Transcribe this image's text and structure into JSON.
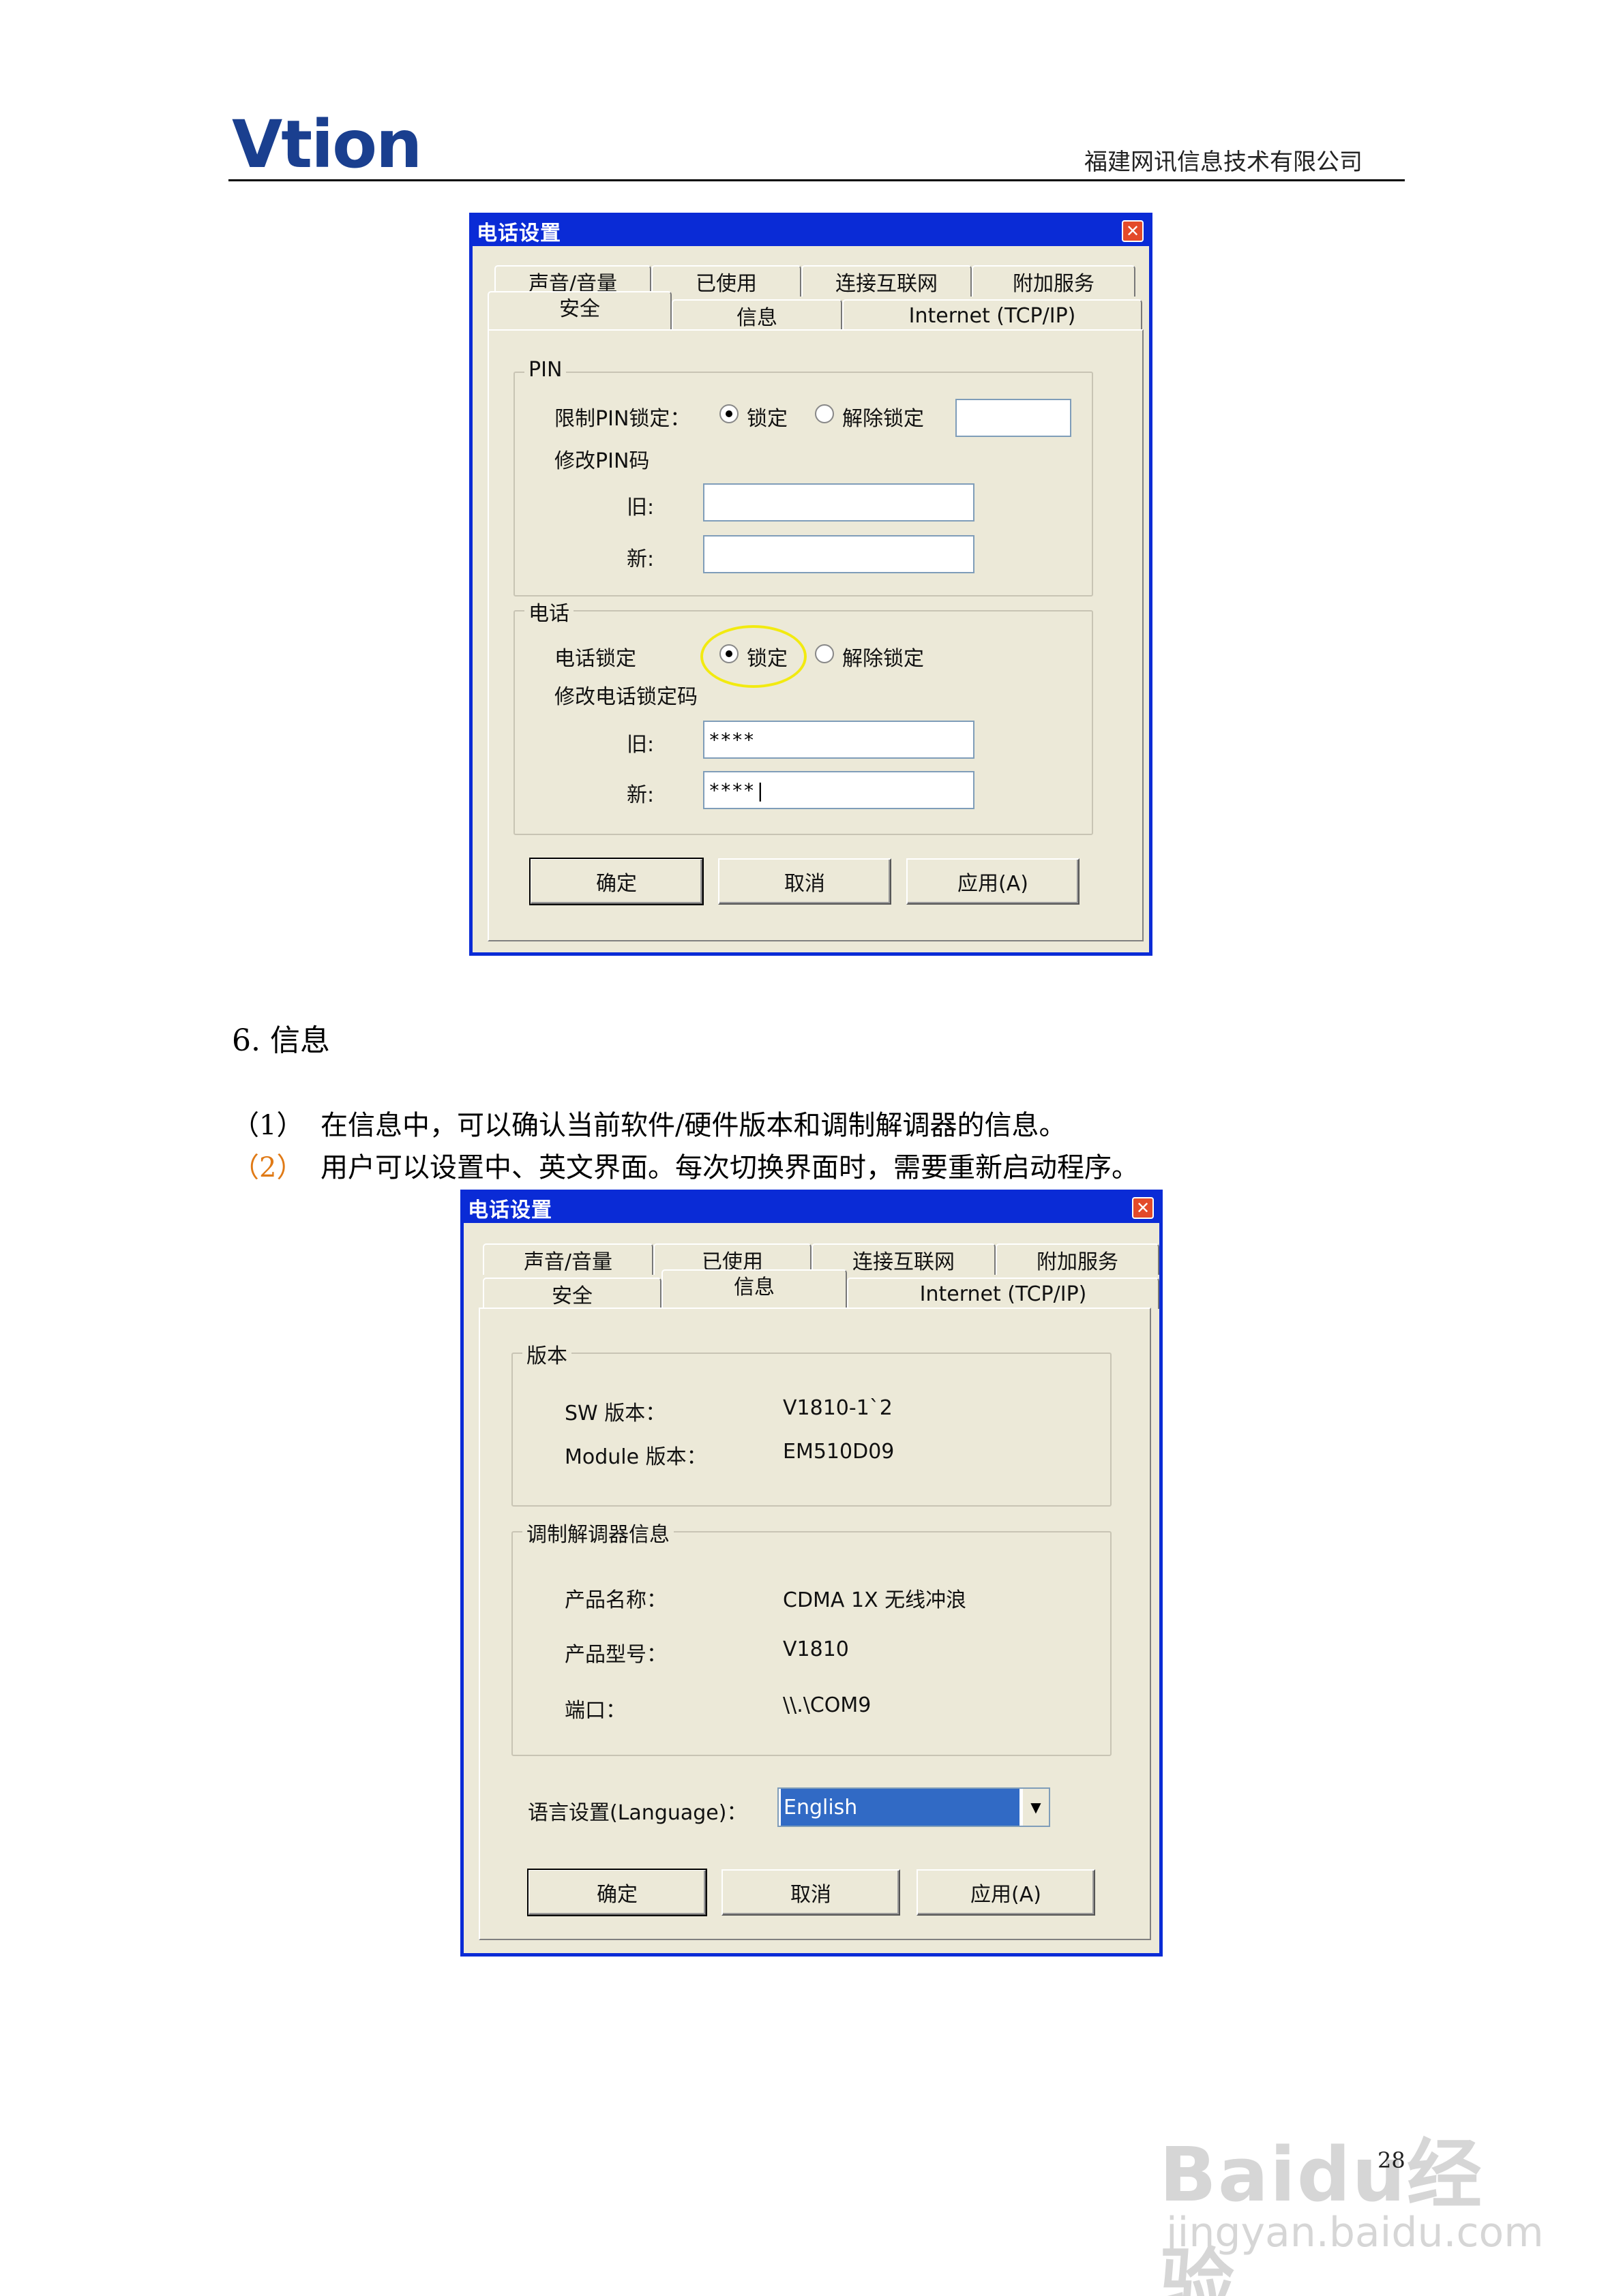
{
  "header": {
    "logo_text": "Vtion",
    "company": "福建网讯信息技术有限公司"
  },
  "dialog1": {
    "title": "电话设置",
    "tabs_row1": [
      "声音/音量",
      "已使用",
      "连接互联网",
      "附加服务"
    ],
    "tabs_row2": [
      "安全",
      "信息",
      "Internet (TCP/IP)"
    ],
    "active_tab": "安全",
    "pin_group": {
      "legend": "PIN",
      "restrict_label": "限制PIN锁定：",
      "lock_label": "锁定",
      "unlock_label": "解除锁定",
      "change_label": "修改PIN码",
      "old_label": "旧:",
      "new_label": "新:",
      "old_value": "",
      "new_value": ""
    },
    "phone_group": {
      "legend": "电话",
      "lock_label_main": "电话锁定",
      "lock_label": "锁定",
      "unlock_label": "解除锁定",
      "change_label": "修改电话锁定码",
      "old_label": "旧:",
      "new_label": "新:",
      "old_value": "****",
      "new_value": "****|"
    },
    "buttons": {
      "ok": "确定",
      "cancel": "取消",
      "apply": "应用(A)"
    }
  },
  "section": {
    "heading": "6.  信息",
    "item1_num": "（1）",
    "item1_text": "在信息中，可以确认当前软件/硬件版本和调制解调器的信息。",
    "item2_num": "（2）",
    "item2_text": "用户可以设置中、英文界面。每次切换界面时，需要重新启动程序。"
  },
  "dialog2": {
    "title": "电话设置",
    "tabs_row1": [
      "声音/音量",
      "已使用",
      "连接互联网",
      "附加服务"
    ],
    "tabs_row2": [
      "安全",
      "信息",
      "Internet (TCP/IP)"
    ],
    "active_tab": "信息",
    "version_group": {
      "legend": "版本",
      "sw_label": "SW 版本：",
      "sw_value": "V1810-1`2",
      "module_label": "Module 版本：",
      "module_value": "EM510D09"
    },
    "modem_group": {
      "legend": "调制解调器信息",
      "name_label": "产品名称：",
      "name_value": "CDMA 1X 无线冲浪",
      "model_label": "产品型号：",
      "model_value": "V1810",
      "port_label": "端口：",
      "port_value": "\\\\.\\COM9"
    },
    "language_label": "语言设置(Language)：",
    "language_value": "English",
    "buttons": {
      "ok": "确定",
      "cancel": "取消",
      "apply": "应用(A)"
    }
  },
  "footer": {
    "page_number": "28",
    "watermark_brand": "Baidu经验",
    "watermark_url": "jingyan.baidu.com"
  }
}
